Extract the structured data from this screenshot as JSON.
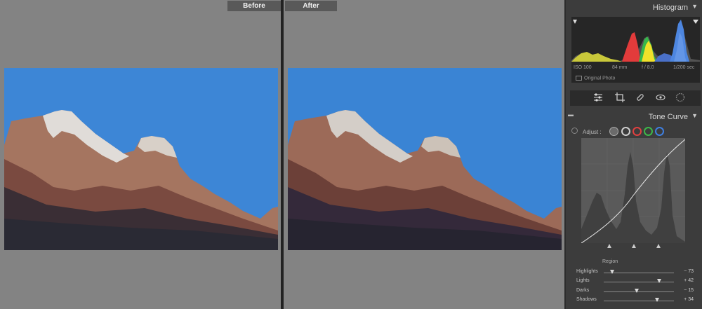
{
  "compare": {
    "before_label": "Before",
    "after_label": "After"
  },
  "histogram": {
    "title": "Histogram",
    "iso": "ISO 100",
    "focal": "84 mm",
    "aperture": "f / 8.0",
    "shutter": "1/200 sec",
    "original_photo": "Original Photo"
  },
  "tone_curve": {
    "title": "Tone Curve",
    "adjust_label": "Adjust :",
    "channel_colors": [
      "#cfcfcf",
      "#e04040",
      "#3db84a",
      "#3f7fe0"
    ],
    "region_label": "Region",
    "sliders": [
      {
        "label": "Highlights",
        "value": "− 73",
        "level": 0.12
      },
      {
        "label": "Lights",
        "value": "+ 42",
        "level": 0.79
      },
      {
        "label": "Darks",
        "value": "− 15",
        "level": 0.47
      },
      {
        "label": "Shadows",
        "value": "+ 34",
        "level": 0.76
      }
    ]
  },
  "icons": {
    "tools": [
      "sliders-icon",
      "crop-icon",
      "heal-icon",
      "redeye-icon",
      "mask-icon"
    ]
  }
}
